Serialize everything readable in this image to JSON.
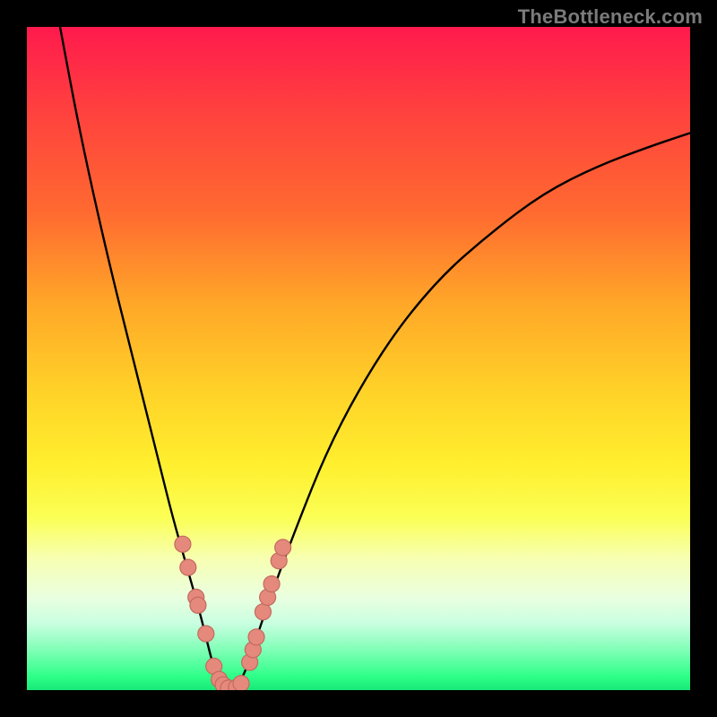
{
  "watermark": "TheBottleneck.com",
  "chart_data": {
    "type": "line",
    "title": "",
    "subtitle": "",
    "xlabel": "",
    "ylabel": "",
    "xlim": [
      0,
      100
    ],
    "ylim": [
      0,
      100
    ],
    "grid": false,
    "legend": false,
    "annotations": [],
    "background_gradient": {
      "direction": "vertical",
      "stops": [
        {
          "pos": 0,
          "color": "#ff1a4d"
        },
        {
          "pos": 28,
          "color": "#ff6a30"
        },
        {
          "pos": 55,
          "color": "#ffd228"
        },
        {
          "pos": 74,
          "color": "#fbff55"
        },
        {
          "pos": 86,
          "color": "#eaffe0"
        },
        {
          "pos": 100,
          "color": "#18e878"
        }
      ]
    },
    "series": [
      {
        "name": "bottleneck-curve",
        "color": "#000000",
        "x": [
          5,
          8,
          12,
          16,
          20,
          22,
          24,
          26,
          27,
          28,
          29,
          30,
          31,
          32,
          33,
          34,
          36,
          40,
          46,
          54,
          62,
          70,
          78,
          86,
          94,
          100
        ],
        "values": [
          100,
          84,
          66,
          50,
          34,
          26,
          19,
          12,
          8,
          4,
          1,
          0,
          0,
          1,
          3,
          6,
          12,
          23,
          38,
          52,
          62,
          69,
          75,
          79,
          82,
          84
        ]
      }
    ],
    "markers": {
      "name": "highlight-beads",
      "color": "#e5897d",
      "x": [
        23.5,
        24.3,
        25.5,
        25.8,
        27.0,
        28.2,
        29.0,
        29.6,
        30.4,
        31.6,
        32.3,
        33.6,
        34.1,
        34.6,
        35.6,
        36.3,
        36.9,
        38.0,
        38.6
      ],
      "values": [
        22.0,
        18.5,
        14.0,
        12.8,
        8.5,
        3.6,
        1.6,
        0.8,
        0.3,
        0.4,
        1.0,
        4.2,
        6.1,
        8.0,
        11.8,
        14.0,
        16.0,
        19.5,
        21.5
      ]
    }
  }
}
